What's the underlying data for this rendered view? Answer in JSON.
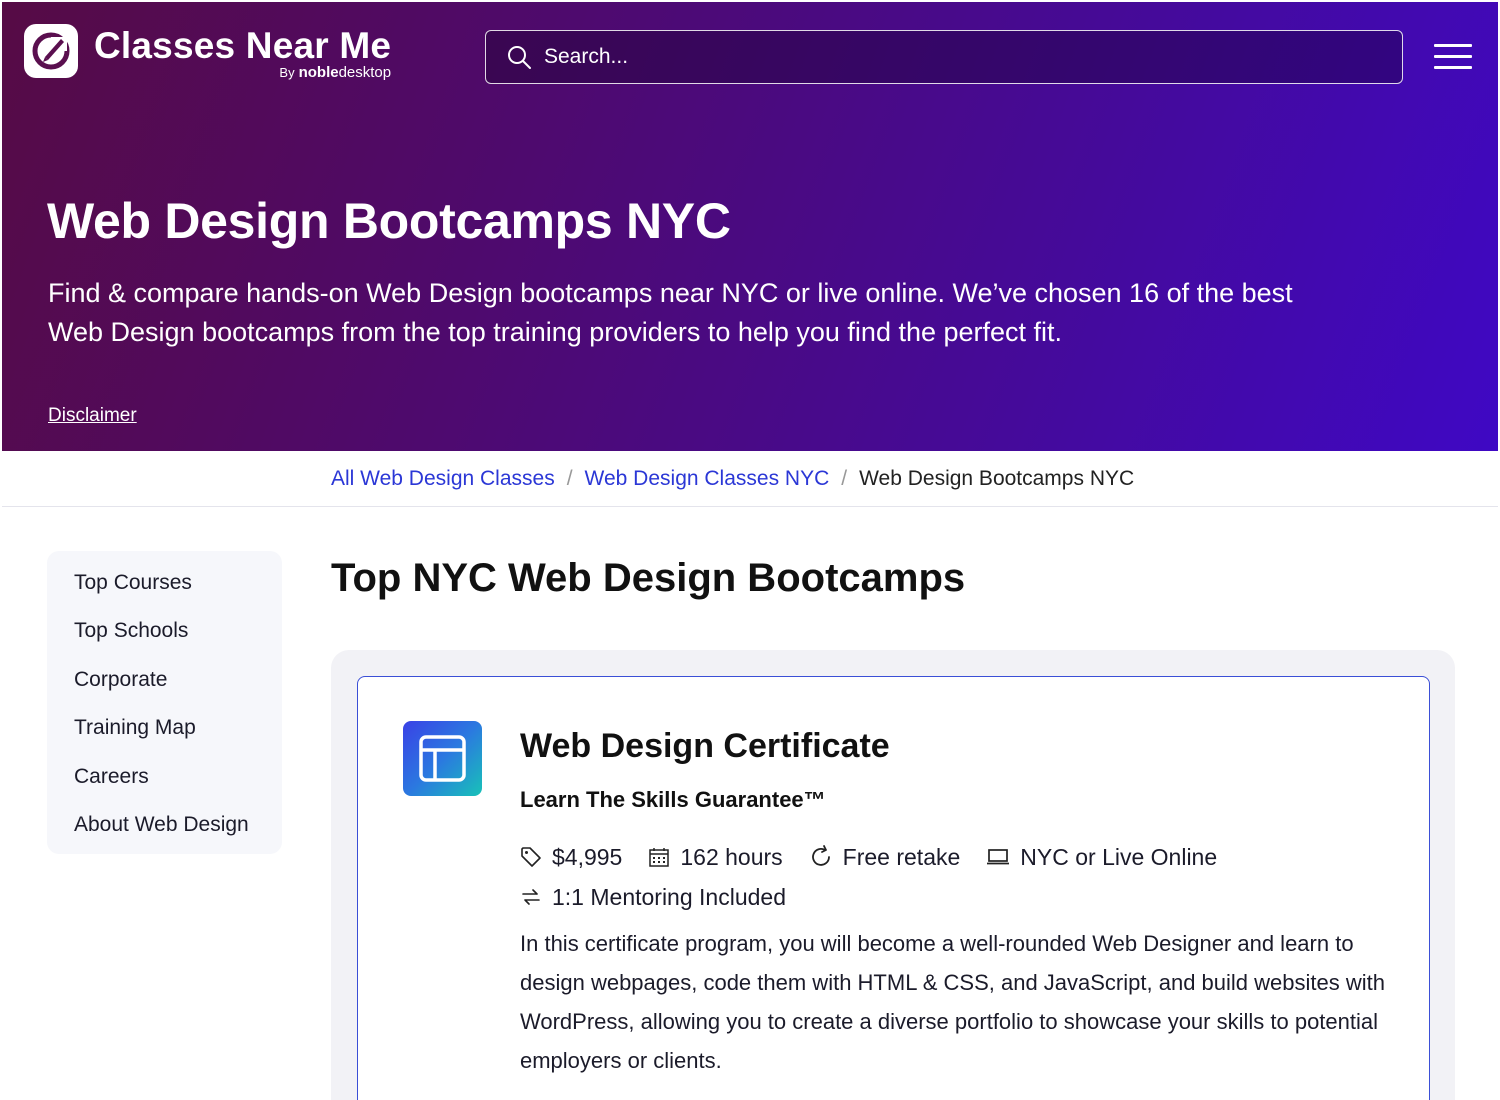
{
  "brand": {
    "title": "Classes Near Me",
    "by": "By",
    "noble": "noble",
    "desktop": "desktop"
  },
  "search": {
    "placeholder": "Search..."
  },
  "hero": {
    "title": "Web Design Bootcamps NYC",
    "description": "Find & compare hands-on Web Design bootcamps near NYC or live online. We’ve chosen 16 of the best Web Design bootcamps from the top training providers to help you find the perfect fit.",
    "disclaimer": "Disclaimer"
  },
  "breadcrumb": {
    "items": [
      "All Web Design Classes",
      "Web Design Classes NYC"
    ],
    "separator": "/",
    "current": "Web Design Bootcamps NYC"
  },
  "sidebar": {
    "items": [
      {
        "label": "Top Courses"
      },
      {
        "label": "Top Schools"
      },
      {
        "label": "Corporate"
      },
      {
        "label": "Training Map"
      },
      {
        "label": "Careers"
      },
      {
        "label": "About Web Design"
      }
    ]
  },
  "main": {
    "section_title": "Top NYC Web Design Bootcamps",
    "card": {
      "title": "Web Design Certificate",
      "guarantee": "Learn The Skills Guarantee™",
      "price": "$4,995",
      "hours": "162 hours",
      "retake": "Free retake",
      "location": "NYC or Live Online",
      "mentoring": "1:1 Mentoring Included",
      "description": "In this certificate program, you will become a well-rounded Web Designer and learn to design webpages, code them with HTML & CSS, and JavaScript, and build websites with WordPress, allowing you to create a diverse portfolio to showcase your skills to potential employers or clients."
    }
  },
  "colors": {
    "link": "#2b37d6",
    "hero_start": "#560b45",
    "hero_end": "#3f08c4",
    "card_border": "#3b4fd6"
  }
}
